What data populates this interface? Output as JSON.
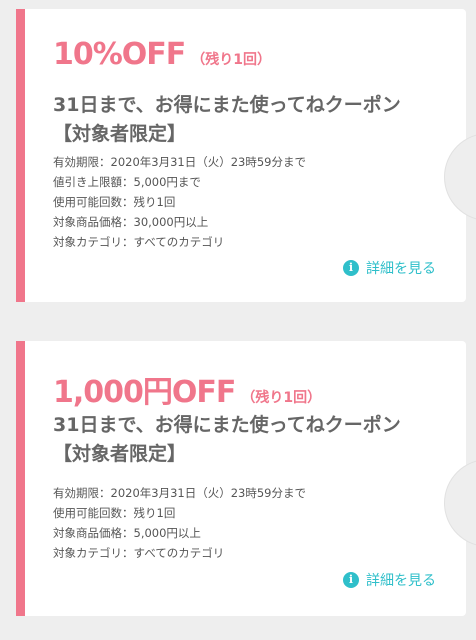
{
  "coupons": [
    {
      "discount": "10%OFF",
      "remaining": "（残り1回）",
      "title": "31日まで、お得にまた使ってねクーポン【対象者限定】",
      "details": [
        "有効期限：2020年3月31日（火）23時59分まで",
        "値引き上限額：5,000円まで",
        "使用可能回数：残り1回",
        "対象商品価格：30,000円以上",
        "対象カテゴリ：すべてのカテゴリ"
      ],
      "more_label": "詳細を見る",
      "more_icon": "info-icon"
    },
    {
      "discount": "1,000円OFF",
      "remaining": "（残り1回）",
      "title": "31日まで、お得にまた使ってねクーポン【対象者限定】",
      "details": [
        "有効期限：2020年3月31日（火）23時59分まで",
        "使用可能回数：残り1回",
        "対象商品価格：5,000円以上",
        "対象カテゴリ：すべてのカテゴリ"
      ],
      "more_label": "詳細を見る",
      "more_icon": "info-icon"
    }
  ],
  "colors": {
    "accent_pink": "#f0768b",
    "link_teal": "#2fbfca",
    "title_gray": "#666666",
    "background": "#eeeeee"
  }
}
